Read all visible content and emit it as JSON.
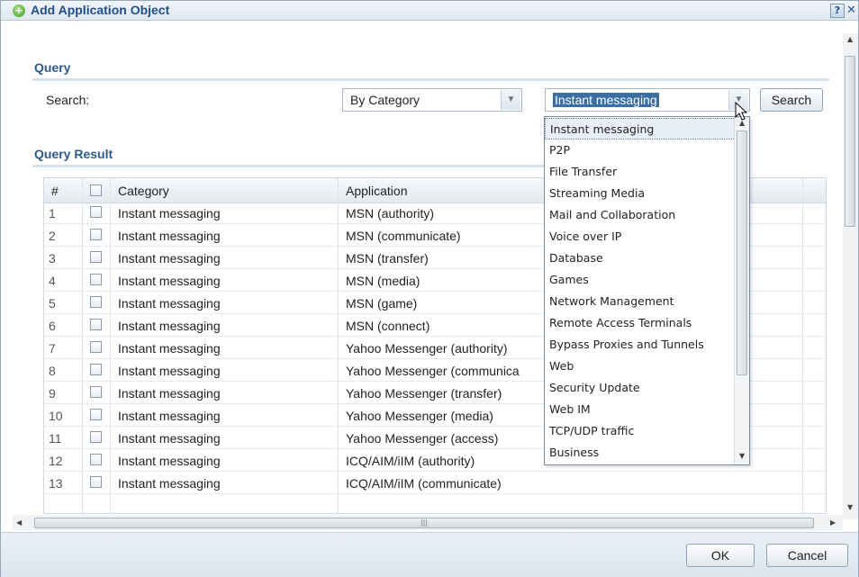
{
  "dialog": {
    "title": "Add Application Object",
    "help_label": "?",
    "close_label": "✕"
  },
  "query": {
    "section_title": "Query",
    "search_label": "Search:",
    "by_select_value": "By Category",
    "category_select_value": "Instant messaging",
    "search_button": "Search"
  },
  "dropdown": {
    "options": [
      "Instant messaging",
      "P2P",
      "File Transfer",
      "Streaming Media",
      "Mail and Collaboration",
      "Voice over IP",
      "Database",
      "Games",
      "Network Management",
      "Remote Access Terminals",
      "Bypass Proxies and Tunnels",
      "Web",
      "Security Update",
      "Web IM",
      "TCP/UDP traffic",
      "Business"
    ],
    "selected_index": 0
  },
  "result": {
    "section_title": "Query Result",
    "columns": {
      "num": "#",
      "category": "Category",
      "application": "Application"
    },
    "rows": [
      {
        "num": "1",
        "category": "Instant messaging",
        "application": "MSN (authority)"
      },
      {
        "num": "2",
        "category": "Instant messaging",
        "application": "MSN (communicate)"
      },
      {
        "num": "3",
        "category": "Instant messaging",
        "application": "MSN (transfer)"
      },
      {
        "num": "4",
        "category": "Instant messaging",
        "application": "MSN (media)"
      },
      {
        "num": "5",
        "category": "Instant messaging",
        "application": "MSN (game)"
      },
      {
        "num": "6",
        "category": "Instant messaging",
        "application": "MSN (connect)"
      },
      {
        "num": "7",
        "category": "Instant messaging",
        "application": "Yahoo Messenger (authority)"
      },
      {
        "num": "8",
        "category": "Instant messaging",
        "application": "Yahoo Messenger (communica"
      },
      {
        "num": "9",
        "category": "Instant messaging",
        "application": "Yahoo Messenger (transfer)"
      },
      {
        "num": "10",
        "category": "Instant messaging",
        "application": "Yahoo Messenger (media)"
      },
      {
        "num": "11",
        "category": "Instant messaging",
        "application": "Yahoo Messenger (access)"
      },
      {
        "num": "12",
        "category": "Instant messaging",
        "application": "ICQ/AIM/iIM (authority)"
      },
      {
        "num": "13",
        "category": "Instant messaging",
        "application": "ICQ/AIM/iIM (communicate)"
      }
    ]
  },
  "footer": {
    "ok_button": "OK",
    "cancel_button": "Cancel"
  },
  "icons": {
    "title_icon": "add-circle-icon",
    "arrow": "chevron-down-icon"
  },
  "colors": {
    "accent": "#2a5a8f",
    "selection": "#3a6ea5",
    "footer_bg": "#dce5ee"
  }
}
